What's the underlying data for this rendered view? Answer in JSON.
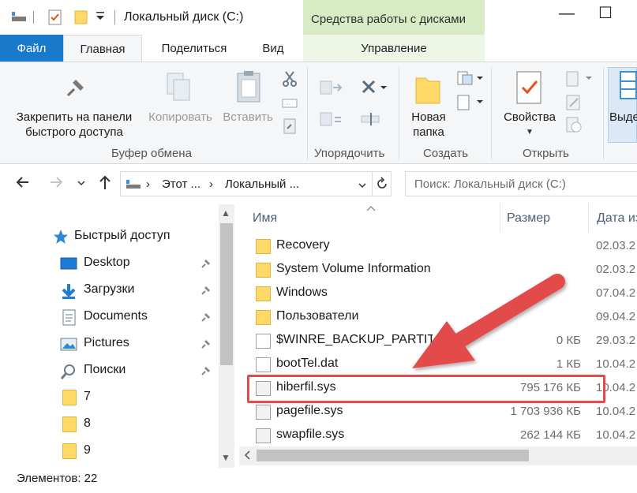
{
  "window": {
    "title": "Локальный диск (C:)",
    "context_group": "Средства работы с дисками",
    "minimize": "—",
    "maximize": "☐"
  },
  "tabs": [
    "Файл",
    "Главная",
    "Поделиться",
    "Вид",
    "Управление"
  ],
  "ribbon": {
    "pin_label_1": "Закрепить на панели",
    "pin_label_2": "быстрого доступа",
    "copy": "Копировать",
    "paste": "Вставить",
    "clipboard_group": "Буфер обмена",
    "organize_group": "Упорядочить",
    "new_folder_1": "Новая",
    "new_folder_2": "папка",
    "create_group": "Создать",
    "properties": "Свойства",
    "open_group": "Открыть",
    "select_partial": "Выде"
  },
  "address": {
    "seg1": "Этот ...",
    "seg2": "Локальный ...",
    "search_placeholder": "Поиск: Локальный диск (C:)"
  },
  "navpane": {
    "items": [
      {
        "label": "Быстрый доступ",
        "icon": "star-icon",
        "pinned": false
      },
      {
        "label": "Desktop",
        "icon": "desktop-icon",
        "pinned": true
      },
      {
        "label": "Загрузки",
        "icon": "download-icon",
        "pinned": true
      },
      {
        "label": "Documents",
        "icon": "documents-icon",
        "pinned": true
      },
      {
        "label": "Pictures",
        "icon": "pictures-icon",
        "pinned": true
      },
      {
        "label": "Поиски",
        "icon": "search-icon",
        "pinned": true
      },
      {
        "label": "7",
        "icon": "folder-icon",
        "pinned": false
      },
      {
        "label": "8",
        "icon": "folder-icon",
        "pinned": false
      },
      {
        "label": "9",
        "icon": "folder-icon",
        "pinned": false
      }
    ]
  },
  "columns": {
    "name": "Имя",
    "size": "Размер",
    "date": "Дата из"
  },
  "files": [
    {
      "name": "Recovery",
      "size": "",
      "date": "02.03.2",
      "type": "folder"
    },
    {
      "name": "System Volume Information",
      "size": "",
      "date": "02.03.2",
      "type": "folder"
    },
    {
      "name": "Windows",
      "size": "",
      "date": "07.04.2",
      "type": "folder"
    },
    {
      "name": "Пользователи",
      "size": "",
      "date": "09.04.2",
      "type": "folder"
    },
    {
      "name": "$WINRE_BACKUP_PARTITI",
      "size": "0 КБ",
      "date": "29.03.2",
      "type": "doc"
    },
    {
      "name": "bootTel.dat",
      "size": "1 КБ",
      "date": "10.04.2",
      "type": "doc"
    },
    {
      "name": "hiberfil.sys",
      "size": "795 176 КБ",
      "date": "10.04.2",
      "type": "sys"
    },
    {
      "name": "pagefile.sys",
      "size": "1 703 936 КБ",
      "date": "10.04.2",
      "type": "sys"
    },
    {
      "name": "swapfile.sys",
      "size": "262 144 КБ",
      "date": "10.04.2",
      "type": "sys"
    }
  ],
  "status": {
    "items_count": "Элементов: 22"
  },
  "colors": {
    "file_tab": "#1979ca",
    "context_tab": "#d7ecc4",
    "highlight": "#e34b4b",
    "arrow": "#e34b4b"
  }
}
